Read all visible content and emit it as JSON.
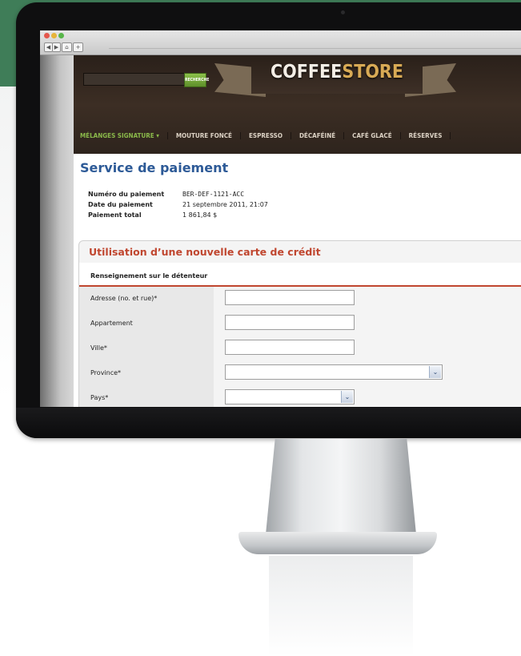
{
  "browser": {
    "nav_buttons": [
      "◀",
      "▶",
      "⌂",
      "+"
    ]
  },
  "store": {
    "brand_part1": "COFFEE",
    "brand_part2": "STORE",
    "search_button": "RECHERCHE",
    "nav": [
      "MÉLANGES SIGNATURE",
      "MOUTURE FONCÉ",
      "ESPRESSO",
      "DÉCAFÉINÉ",
      "CAFÉ GLACÉ",
      "RÉSERVES"
    ],
    "nav_dropdown": "▾",
    "colors": {
      "header": "#3c2e24",
      "accent_green": "#8ab94a",
      "title_blue": "#2d5a97",
      "section_red": "#c0462f"
    }
  },
  "page": {
    "title": "Service de paiement",
    "info": [
      {
        "label": "Numéro du paiement",
        "value": "BER-DEF-1121-ACC"
      },
      {
        "label": "Date du paiement",
        "value": "21 septembre 2011,  21:07"
      },
      {
        "label": "Paiement total",
        "value": "1 861,84 $"
      }
    ]
  },
  "form": {
    "section_title": "Utilisation d’une nouvelle carte de crédit",
    "subsection_title": "Renseignement sur le détenteur",
    "fields": [
      {
        "label": "Adresse (no. et rue)*",
        "value": ""
      },
      {
        "label": "Appartement",
        "value": ""
      },
      {
        "label": "Ville*",
        "value": ""
      },
      {
        "label": "Province*",
        "value": ""
      },
      {
        "label": "Pays*",
        "value": ""
      }
    ],
    "select_arrow": "⌄"
  }
}
